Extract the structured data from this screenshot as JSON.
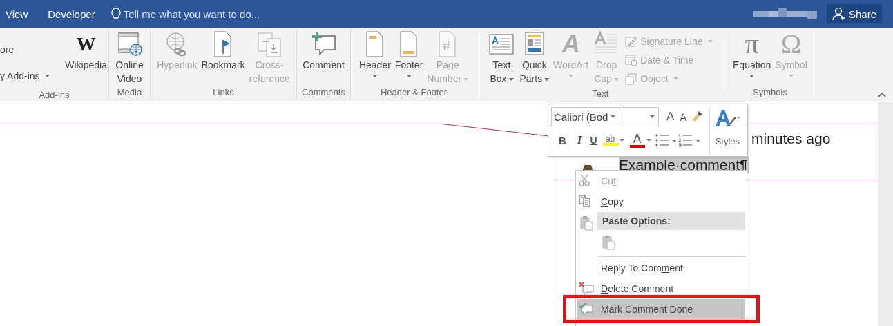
{
  "title_bar": {
    "tabs": [
      {
        "label": "View"
      },
      {
        "label": "Developer"
      }
    ],
    "tell_me": {
      "placeholder": "Tell me what you want to do..."
    },
    "share_button": "Share"
  },
  "ribbon": {
    "groups": [
      {
        "label": "Add-ins",
        "items": [
          {
            "kind": "stack",
            "items": [
              {
                "label": "ore",
                "disabled": false,
                "caret": false
              },
              {
                "label": "y Add-ins",
                "disabled": false,
                "caret": true
              }
            ]
          },
          {
            "kind": "large",
            "glyph": "W",
            "label": "Wikipedia",
            "disabled": false,
            "caret": false
          }
        ]
      },
      {
        "label": "Media",
        "items": [
          {
            "kind": "large",
            "label": "Online\nVideo",
            "disabled": false,
            "caret": false
          }
        ]
      },
      {
        "label": "Links",
        "items": [
          {
            "kind": "large",
            "label": "Hyperlink",
            "disabled": true,
            "caret": false
          },
          {
            "kind": "large",
            "label": "Bookmark",
            "disabled": false,
            "caret": false
          },
          {
            "kind": "large",
            "label": "Cross-\nreference",
            "disabled": true,
            "caret": false
          }
        ]
      },
      {
        "label": "Comments",
        "items": [
          {
            "kind": "large",
            "label": "Comment",
            "disabled": false,
            "caret": false
          }
        ]
      },
      {
        "label": "Header & Footer",
        "items": [
          {
            "kind": "large",
            "label": "Header",
            "disabled": false,
            "caret": true
          },
          {
            "kind": "large",
            "label": "Footer",
            "disabled": false,
            "caret": true
          },
          {
            "kind": "large",
            "label": "Page\nNumber",
            "disabled": true,
            "caret": true
          }
        ]
      },
      {
        "label": "Text",
        "items": [
          {
            "kind": "large",
            "label": "Text\nBox",
            "disabled": false,
            "caret": true
          },
          {
            "kind": "large",
            "label": "Quick\nParts",
            "disabled": false,
            "caret": true
          },
          {
            "kind": "large",
            "glyph": "A",
            "label": "WordArt",
            "disabled": true,
            "caret": true
          },
          {
            "kind": "large",
            "label": "Drop\nCap",
            "disabled": true,
            "caret": true
          },
          {
            "kind": "stack",
            "items": [
              {
                "label": "Signature Line",
                "disabled": true,
                "caret": true
              },
              {
                "label": "Date & Time",
                "disabled": true,
                "caret": false
              },
              {
                "label": "Object",
                "disabled": true,
                "caret": true
              }
            ]
          }
        ]
      },
      {
        "label": "Symbols",
        "items": [
          {
            "kind": "large",
            "glyph": "π",
            "label": "Equation",
            "disabled": false,
            "caret": true
          },
          {
            "kind": "large",
            "glyph": "Ω",
            "label": "Symbol",
            "disabled": true,
            "caret": true
          }
        ]
      }
    ]
  },
  "comment": {
    "time": "minutes ago",
    "text": "Example·comment¶",
    "selected": true
  },
  "mini_toolbar": {
    "font_field": {
      "value": "Calibri (Bod"
    },
    "grow_font": "A",
    "shrink_font": "A",
    "bold": "B",
    "italic": "I",
    "underline": "U",
    "highlight": "ab",
    "font_color": "A",
    "styles": "Styles"
  },
  "context_menu": {
    "items": [
      {
        "kind": "item",
        "before": "Cu",
        "key": "t",
        "disabled": true,
        "selected": false,
        "annotated": false
      },
      {
        "kind": "item",
        "key": "C",
        "after": "opy",
        "disabled": false,
        "selected": false,
        "annotated": false
      },
      {
        "kind": "header",
        "label": "Paste Options:"
      },
      {
        "kind": "paste-icons"
      },
      {
        "kind": "separator"
      },
      {
        "kind": "item",
        "before": "Reply To Com",
        "key": "m",
        "after": "ent",
        "disabled": false,
        "selected": false,
        "annotated": false
      },
      {
        "kind": "item",
        "key": "D",
        "after": "elete Comment",
        "disabled": false,
        "selected": false,
        "annotated": false
      },
      {
        "kind": "item",
        "before": "Mark C",
        "key": "o",
        "after": "mment Done",
        "disabled": false,
        "selected": true,
        "annotated": true
      }
    ]
  }
}
